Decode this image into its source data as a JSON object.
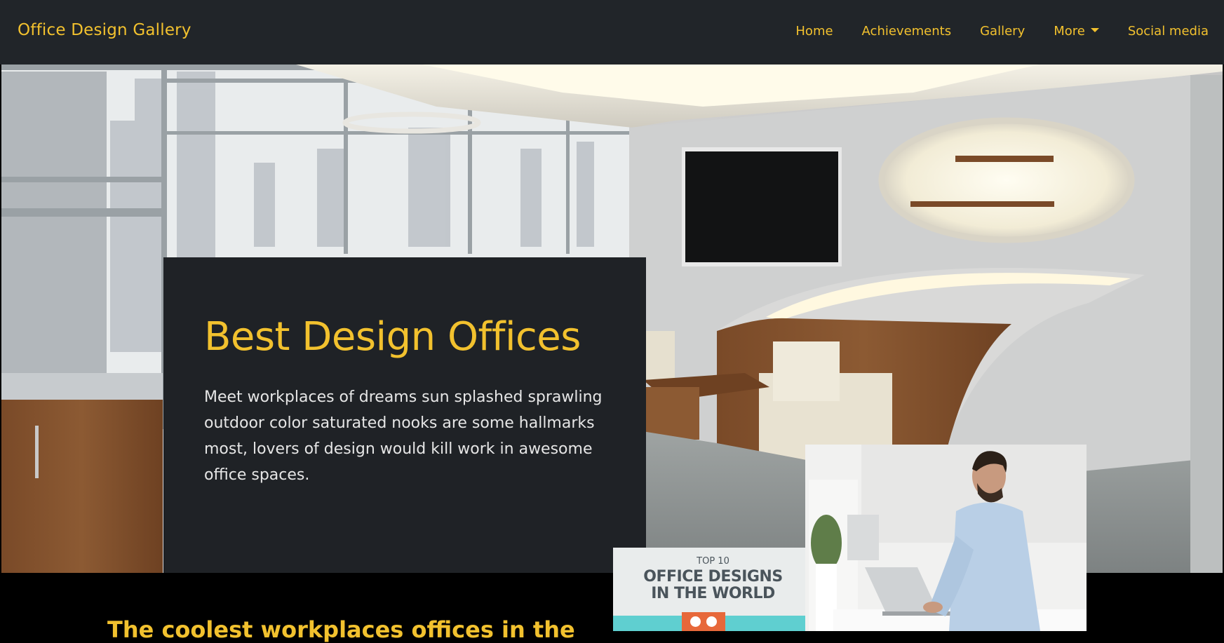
{
  "navbar": {
    "brand": "Office Design Gallery",
    "links": {
      "home": "Home",
      "achievements": "Achievements",
      "gallery": "Gallery",
      "more": "More",
      "social": "Social media"
    }
  },
  "hero": {
    "title": "Best Design Offices",
    "text": "Meet workplaces of dreams sun splashed sprawling outdoor color saturated nooks are some hallmarks most, lovers of design would kill work in awesome office spaces."
  },
  "section": {
    "heading": "The coolest workplaces offices in the"
  },
  "poster": {
    "kicker": "TOP 10",
    "title_line1": "OFFICE DESIGNS",
    "title_line2": "IN THE WORLD"
  },
  "colors": {
    "accent": "#f2c12e",
    "navbar_bg": "#212529",
    "card_bg": "#1f2226"
  }
}
